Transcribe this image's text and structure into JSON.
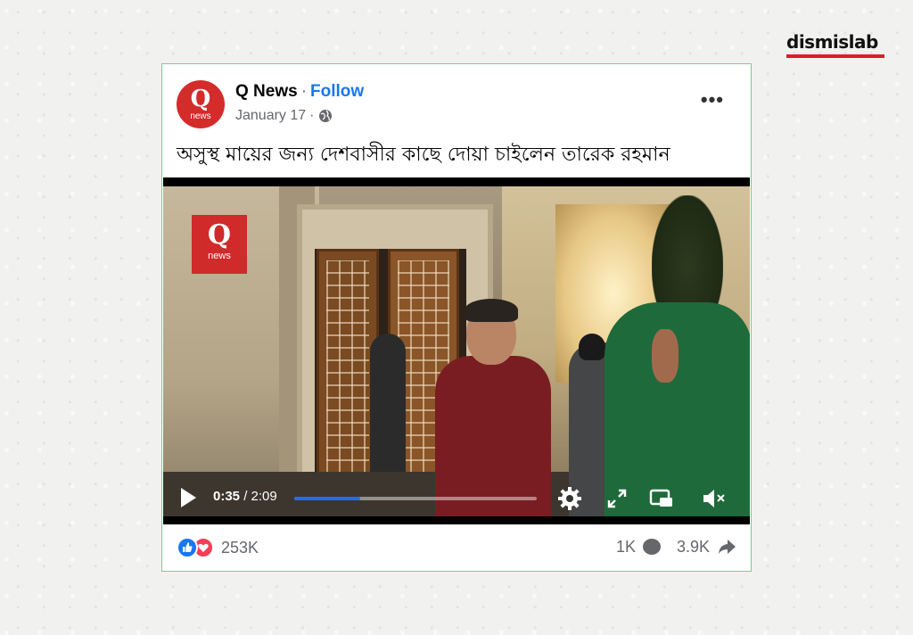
{
  "brand": {
    "logo_text": "dismislab",
    "accent_color": "#e21a2c"
  },
  "post": {
    "page_name": "Q News",
    "separator": "·",
    "follow_label": "Follow",
    "date": "January 17",
    "date_separator": "·",
    "privacy_icon": "globe-icon",
    "more_label": "•••",
    "avatar": {
      "logo_letter": "Q",
      "logo_word": "news",
      "color": "#d42b2b"
    },
    "caption": "অসুস্থ মায়ের জন্য দেশবাসীর কাছে দোয়া চাইলেন তারেক রহমান"
  },
  "video": {
    "overlay_logo": {
      "letter": "Q",
      "word": "news"
    },
    "current_time": "0:35",
    "time_separator": " / ",
    "duration": "2:09",
    "progress_fraction": 0.271,
    "icons": [
      "play-icon",
      "settings-gear-icon",
      "fullscreen-icon",
      "picture-in-picture-icon",
      "mute-icon"
    ]
  },
  "footer": {
    "reactions": [
      "like-icon",
      "love-icon"
    ],
    "reaction_count": "253K",
    "comment_count": "1K",
    "share_count": "3.9K"
  },
  "colors": {
    "frame_border": "#7dc99a",
    "follow": "#1877f2",
    "progress": "#1f6feb"
  }
}
